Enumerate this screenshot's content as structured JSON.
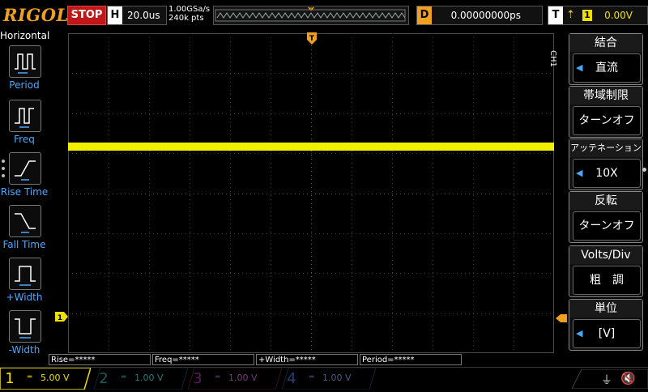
{
  "top": {
    "brand": "RIGOL",
    "run_state": "STOP",
    "h_label": "H",
    "timebase": "20.0us",
    "sample_rate": "1.00GSa/s",
    "points": "240k pts",
    "delay_label": "D",
    "delay_value": "0.00000000ps",
    "trigger_label": "T",
    "trigger_source": "1",
    "trigger_level": "0.00V"
  },
  "left_panel": {
    "title": "Horizontal",
    "items": [
      {
        "label": "Period",
        "icon": "period-icon"
      },
      {
        "label": "Freq",
        "icon": "frequency-icon"
      },
      {
        "label": "Rise Time",
        "icon": "rise-time-icon"
      },
      {
        "label": "Fall Time",
        "icon": "fall-time-icon"
      },
      {
        "label": "+Width",
        "icon": "positive-width-icon"
      },
      {
        "label": "-Width",
        "icon": "negative-width-icon"
      }
    ]
  },
  "right_panel": {
    "channel": "CH1",
    "items": [
      {
        "label": "結合",
        "value": "直流",
        "arrow": true
      },
      {
        "label": "帯域制限",
        "value": "ターンオフ",
        "arrow": false
      },
      {
        "label": "アッテネーション",
        "value": "10X",
        "arrow": true
      },
      {
        "label": "反転",
        "value": "ターンオフ",
        "arrow": false
      },
      {
        "label": "Volts/Div",
        "value": "粗　調",
        "arrow": false
      },
      {
        "label": "単位",
        "value": "[V]",
        "arrow": true
      }
    ]
  },
  "measurements": [
    "Rise=*****",
    "Freq=*****",
    "+Width=*****",
    "Period=*****"
  ],
  "channels": [
    {
      "num": "1",
      "value": "5.00 V",
      "color": "#f0e000",
      "active": true
    },
    {
      "num": "2",
      "value": "1.00 V",
      "color": "#2ad0d0",
      "active": false
    },
    {
      "num": "3",
      "value": "1.00 V",
      "color": "#d040d0",
      "active": false
    },
    {
      "num": "4",
      "value": "1.00 V",
      "color": "#3a6aff",
      "active": false
    }
  ],
  "markers": {
    "ch1_ground": "1",
    "trigger_pos": "T"
  },
  "colors": {
    "trace": "#f0f000",
    "accent": "#f0a020",
    "grid": "#3a3a3a"
  }
}
